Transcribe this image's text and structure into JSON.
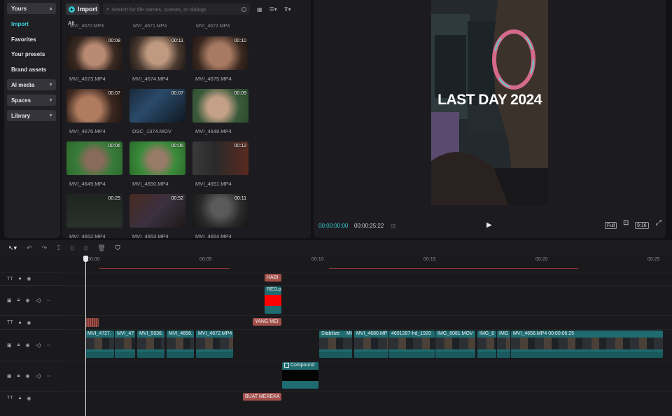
{
  "nav": {
    "header": "Yours",
    "items": [
      {
        "label": "Import"
      },
      {
        "label": "Favorites"
      },
      {
        "label": "Your presets"
      },
      {
        "label": "Brand assets"
      }
    ],
    "groups": [
      {
        "label": "AI media"
      },
      {
        "label": "Spaces"
      },
      {
        "label": "Library"
      }
    ]
  },
  "media": {
    "import_label": "Import",
    "search_placeholder": "Search for file names, scenes, or dialogs",
    "filter_all": "All",
    "top_names": [
      "MVI_4670.MP4",
      "MVI_4671.MP4",
      "MVI_4672.MP4"
    ],
    "clips": [
      {
        "name": "MVI_4673.MP4",
        "duration": "00:08"
      },
      {
        "name": "MVI_4674.MP4",
        "duration": "00:11"
      },
      {
        "name": "MVI_4675.MP4",
        "duration": "00:10"
      },
      {
        "name": "MVI_4676.MP4",
        "duration": "00:07"
      },
      {
        "name": "DSC_1374.MOV",
        "duration": "00:07"
      },
      {
        "name": "MVI_4648.MP4",
        "duration": "00:09"
      },
      {
        "name": "MVI_4649.MP4",
        "duration": "00:06"
      },
      {
        "name": "MVI_4650.MP4",
        "duration": "00:06"
      },
      {
        "name": "MVI_4651.MP4",
        "duration": "00:12"
      },
      {
        "name": "MVI_4652.MP4",
        "duration": "00:25"
      },
      {
        "name": "MVI_4653.MP4",
        "duration": "00:52"
      },
      {
        "name": "MVI_4654.MP4",
        "duration": "00:11"
      }
    ]
  },
  "player": {
    "overlay_text": "LAST DAY 2024",
    "current_time": "00:00:00:00",
    "total_time": "00:00:25:22",
    "full_label": "Full",
    "ratio_label": "9:16"
  },
  "timeline": {
    "ruler": [
      "00:00",
      "00:05",
      "00:10",
      "00:15",
      "00:20",
      "00:25"
    ],
    "text_clips": [
      {
        "label": "HABI"
      },
      {
        "label": "YANG MEI"
      },
      {
        "label": "BUAT MEREKA"
      }
    ],
    "overlay_clip": "RED.p",
    "compound_clip": "Compound",
    "main_clips": [
      {
        "label": "MVI_4727."
      },
      {
        "label": "MVI_47"
      },
      {
        "label": "MVI_5936."
      },
      {
        "label": "MVI_4656."
      },
      {
        "label": "MVI_4672.MP4"
      },
      {
        "label": "Stabilize"
      },
      {
        "label": "MV"
      },
      {
        "label": "MVI_4680.MP"
      },
      {
        "label": "4601287-hd_1920"
      },
      {
        "label": "IMG_6081.MOV"
      },
      {
        "label": "IMG_6"
      },
      {
        "label": "IMG"
      },
      {
        "label": "MVI_4656.MP4  00:00:06:25"
      }
    ]
  }
}
